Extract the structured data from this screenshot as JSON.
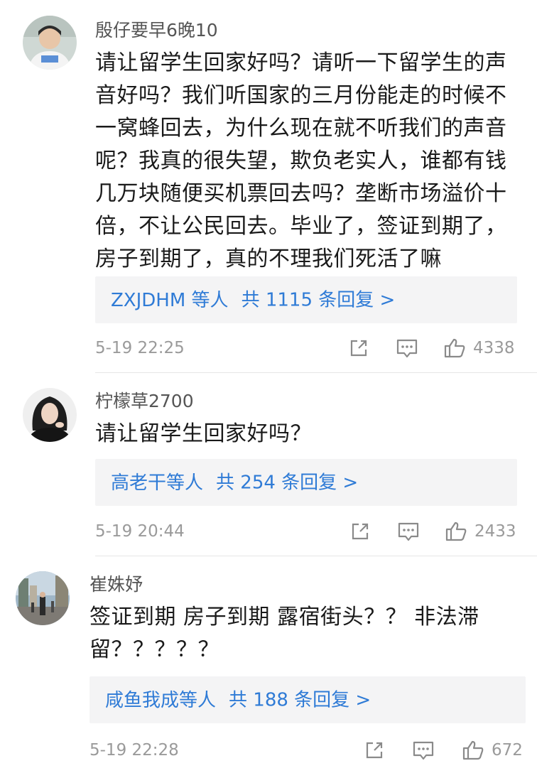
{
  "comments": [
    {
      "username": "殷仔要早6晚10",
      "lines": [
        "请让留学生回家好吗？请听一下留学生的声",
        "音好吗？我们听国家的三月份能走的时候不",
        "一窝蜂回去，为什么现在就不听我们的声音",
        "呢？我真的很失望，欺负老实人，谁都有钱",
        "几万块随便买机票回去吗？垄断市场溢价十",
        "倍，不让公民回去。毕业了，签证到期了，",
        "房子到期了，真的不理我们死活了嘛"
      ],
      "reply_users": "ZXJDHM 等人",
      "reply_count": "共 1115 条回复 >",
      "time": "5-19 22:25",
      "likes": "4338",
      "avatar_icon": "person-avatar"
    },
    {
      "username": "柠檬草2700",
      "lines": [
        "请让留学生回家好吗？"
      ],
      "reply_users": "高老干等人",
      "reply_count": "共 254 条回复 >",
      "time": "5-19 20:44",
      "likes": "2433",
      "avatar_icon": "person-avatar"
    },
    {
      "username": "崔姝妤",
      "lines": [
        "签证到期 房子到期 露宿街头？？ 非法滞",
        "留？？？？？"
      ],
      "reply_users": "咸鱼我成等人",
      "reply_count": "共 188 条回复 >",
      "time": "5-19 22:28",
      "likes": "672",
      "avatar_icon": "street-photo-avatar"
    }
  ],
  "icons": {
    "share": "share-icon",
    "reply": "comment-icon",
    "like": "thumbs-up-icon"
  },
  "colors": {
    "link": "#2f7bd6",
    "meta": "#9a9a9a",
    "reply_bg": "#f4f4f5"
  }
}
